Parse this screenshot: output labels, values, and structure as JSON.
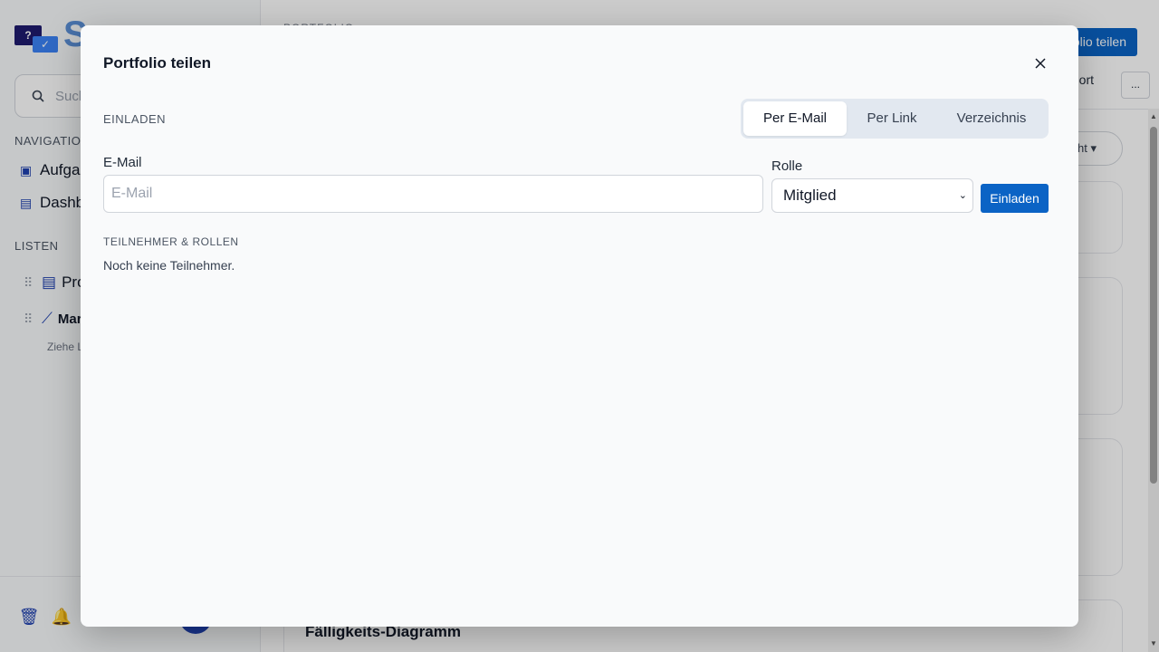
{
  "app": {
    "logo_badge": "?",
    "logo_text": "Scoooge",
    "search_placeholder": "Suchen",
    "nav_section": "NAVIGATION",
    "nav_items": [
      {
        "label": "Aufgaben",
        "icon": "tasks-icon"
      },
      {
        "label": "Dashboard",
        "icon": "document-icon"
      }
    ],
    "lists_section": "LISTEN",
    "list_items": [
      {
        "label": "Projekte",
        "icon": "document-icon"
      },
      {
        "label": "Marketing",
        "icon": "chart-icon"
      }
    ],
    "drag_hint": "Ziehe Listen hierher",
    "breadcrumb": "PORTFOLIO",
    "share_button": "Portfolio teilen",
    "export_button": "Export",
    "more_button": "...",
    "filter_pill": "Ansicht",
    "card_title": "Fälligkeits-Diagramm"
  },
  "modal": {
    "title": "Portfolio teilen",
    "close_icon": "close-icon",
    "invite_label": "EINLADEN",
    "tabs": [
      {
        "label": "Per E-Mail",
        "active": true
      },
      {
        "label": "Per Link",
        "active": false
      },
      {
        "label": "Verzeichnis",
        "active": false
      }
    ],
    "email_label": "E-Mail",
    "email_placeholder": "E-Mail",
    "email_value": "",
    "role_label": "Rolle",
    "role_value": "Mitglied",
    "invite_button": "Einladen",
    "members_label": "TEILNEHMER & ROLLEN",
    "members_empty": "Noch keine Teilnehmer."
  },
  "colors": {
    "primary": "#0b63c5",
    "overlay": "rgba(0,0,0,0.2)",
    "modal_bg": "#f9fafb"
  }
}
